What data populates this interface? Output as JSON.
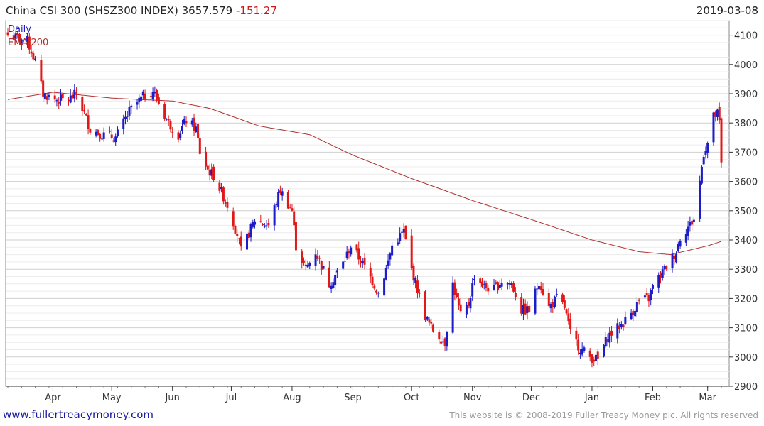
{
  "header": {
    "instrument": "China CSI 300 (SHSZ300 INDEX)",
    "last": "3657.579",
    "change": "-151.27",
    "date": "2019-03-08"
  },
  "legend": {
    "period": "Daily",
    "ema": "EMA 200"
  },
  "footer": {
    "site": "www.fullertreacymoney.com",
    "copyright": "This website is © 2008-2019 Fuller Treacy Money plc. All rights reserved"
  },
  "colors": {
    "up": "#1c1cc8",
    "down": "#e01818",
    "ema": "#b03030",
    "grid": "#d9d9d9",
    "axis": "#333333"
  },
  "chart_data": {
    "type": "candlestick",
    "title": "China CSI 300 (SHSZ300 INDEX) 3657.579 -151.27",
    "frequency": "Daily",
    "ylim": [
      2900,
      4150
    ],
    "yticks": [
      2900,
      3000,
      3100,
      3200,
      3300,
      3400,
      3500,
      3600,
      3700,
      3800,
      3900,
      4000,
      4100
    ],
    "xlim": [
      "2018-03-09",
      "2019-03-08"
    ],
    "months": [
      {
        "label": "Apr",
        "date": "2018-04-01"
      },
      {
        "label": "May",
        "date": "2018-05-01"
      },
      {
        "label": "Jun",
        "date": "2018-06-01"
      },
      {
        "label": "Jul",
        "date": "2018-07-01"
      },
      {
        "label": "Aug",
        "date": "2018-08-01"
      },
      {
        "label": "Sep",
        "date": "2018-09-01"
      },
      {
        "label": "Oct",
        "date": "2018-10-01"
      },
      {
        "label": "Nov",
        "date": "2018-11-01"
      },
      {
        "label": "Dec",
        "date": "2018-12-01"
      },
      {
        "label": "Jan",
        "date": "2019-01-01"
      },
      {
        "label": "Feb",
        "date": "2019-02-01"
      },
      {
        "label": "Mar",
        "date": "2019-03-01"
      }
    ],
    "price_path": [
      [
        "2018-03-09",
        4100
      ],
      [
        "2018-03-14",
        4090
      ],
      [
        "2018-03-19",
        4080
      ],
      [
        "2018-03-23",
        4010
      ],
      [
        "2018-03-27",
        3900
      ],
      [
        "2018-04-02",
        3880
      ],
      [
        "2018-04-09",
        3880
      ],
      [
        "2018-04-13",
        3900
      ],
      [
        "2018-04-20",
        3780
      ],
      [
        "2018-04-26",
        3760
      ],
      [
        "2018-05-03",
        3750
      ],
      [
        "2018-05-10",
        3840
      ],
      [
        "2018-05-17",
        3890
      ],
      [
        "2018-05-22",
        3910
      ],
      [
        "2018-05-30",
        3800
      ],
      [
        "2018-06-04",
        3760
      ],
      [
        "2018-06-08",
        3810
      ],
      [
        "2018-06-13",
        3780
      ],
      [
        "2018-06-15",
        3700
      ],
      [
        "2018-06-19",
        3640
      ],
      [
        "2018-06-22",
        3620
      ],
      [
        "2018-06-29",
        3520
      ],
      [
        "2018-07-04",
        3420
      ],
      [
        "2018-07-06",
        3360
      ],
      [
        "2018-07-13",
        3470
      ],
      [
        "2018-07-20",
        3450
      ],
      [
        "2018-07-26",
        3570
      ],
      [
        "2018-08-01",
        3500
      ],
      [
        "2018-08-03",
        3380
      ],
      [
        "2018-08-08",
        3300
      ],
      [
        "2018-08-13",
        3360
      ],
      [
        "2018-08-20",
        3250
      ],
      [
        "2018-08-27",
        3320
      ],
      [
        "2018-08-31",
        3380
      ],
      [
        "2018-09-05",
        3330
      ],
      [
        "2018-09-11",
        3260
      ],
      [
        "2018-09-14",
        3220
      ],
      [
        "2018-09-18",
        3300
      ],
      [
        "2018-09-21",
        3380
      ],
      [
        "2018-09-27",
        3430
      ],
      [
        "2018-10-01",
        3300
      ],
      [
        "2018-10-08",
        3140
      ],
      [
        "2018-10-11",
        3100
      ],
      [
        "2018-10-18",
        3050
      ],
      [
        "2018-10-22",
        3250
      ],
      [
        "2018-10-26",
        3140
      ],
      [
        "2018-10-30",
        3180
      ],
      [
        "2018-11-02",
        3280
      ],
      [
        "2018-11-07",
        3240
      ],
      [
        "2018-11-12",
        3230
      ],
      [
        "2018-11-16",
        3260
      ],
      [
        "2018-11-21",
        3250
      ],
      [
        "2018-11-26",
        3160
      ],
      [
        "2018-11-30",
        3160
      ],
      [
        "2018-12-05",
        3260
      ],
      [
        "2018-12-10",
        3170
      ],
      [
        "2018-12-14",
        3200
      ],
      [
        "2018-12-18",
        3170
      ],
      [
        "2018-12-21",
        3080
      ],
      [
        "2018-12-26",
        3030
      ],
      [
        "2018-12-31",
        3000
      ],
      [
        "2019-01-04",
        2990
      ],
      [
        "2019-01-09",
        3070
      ],
      [
        "2019-01-16",
        3110
      ],
      [
        "2019-01-22",
        3160
      ],
      [
        "2019-01-25",
        3190
      ],
      [
        "2019-01-30",
        3200
      ],
      [
        "2019-02-01",
        3240
      ],
      [
        "2019-02-13",
        3360
      ],
      [
        "2019-02-15",
        3410
      ],
      [
        "2019-02-22",
        3470
      ],
      [
        "2019-02-25",
        3600
      ],
      [
        "2019-02-27",
        3700
      ],
      [
        "2019-03-01",
        3730
      ],
      [
        "2019-03-04",
        3820
      ],
      [
        "2019-03-06",
        3830
      ],
      [
        "2019-03-07",
        3800
      ],
      [
        "2019-03-08",
        3657.579
      ]
    ],
    "ema200": [
      [
        "2018-03-09",
        3880
      ],
      [
        "2018-04-01",
        3905
      ],
      [
        "2018-05-01",
        3885
      ],
      [
        "2018-06-01",
        3875
      ],
      [
        "2018-06-20",
        3850
      ],
      [
        "2018-07-15",
        3790
      ],
      [
        "2018-08-10",
        3760
      ],
      [
        "2018-09-01",
        3690
      ],
      [
        "2018-10-01",
        3610
      ],
      [
        "2018-11-01",
        3535
      ],
      [
        "2018-12-01",
        3470
      ],
      [
        "2019-01-01",
        3400
      ],
      [
        "2019-01-25",
        3360
      ],
      [
        "2019-02-10",
        3350
      ],
      [
        "2019-03-01",
        3380
      ],
      [
        "2019-03-08",
        3395
      ]
    ]
  }
}
